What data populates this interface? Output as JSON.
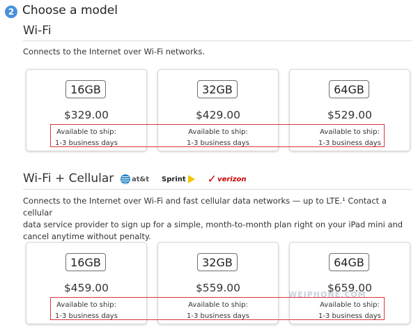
{
  "header": {
    "step_number": "2",
    "title": "Choose a model"
  },
  "wifi": {
    "title": "Wi-Fi",
    "description": "Connects to the Internet over Wi-Fi networks.",
    "models": [
      {
        "capacity": "16GB",
        "price": "$329.00",
        "ship_label": "Available to ship:",
        "ship_time": "1-3 business days"
      },
      {
        "capacity": "32GB",
        "price": "$429.00",
        "ship_label": "Available to ship:",
        "ship_time": "1-3 business days"
      },
      {
        "capacity": "64GB",
        "price": "$529.00",
        "ship_label": "Available to ship:",
        "ship_time": "1-3 business days"
      }
    ]
  },
  "cellular": {
    "title": "Wi-Fi + Cellular",
    "carriers": {
      "att": "at&t",
      "sprint": "Sprint",
      "verizon": "verizon"
    },
    "description_lines": [
      "Connects to the Internet over Wi-Fi and fast cellular data networks — up to LTE.¹ Contact a cellular",
      "data service provider to sign up for a simple, month-to-month plan right on your iPad mini and",
      "cancel anytime without penalty."
    ],
    "models": [
      {
        "capacity": "16GB",
        "price": "$459.00",
        "ship_label": "Available to ship:",
        "ship_time": "1-3 business days"
      },
      {
        "capacity": "32GB",
        "price": "$559.00",
        "ship_label": "Available to ship:",
        "ship_time": "1-3 business days"
      },
      {
        "capacity": "64GB",
        "price": "$659.00",
        "ship_label": "Available to ship:",
        "ship_time": "1-3 business days"
      }
    ]
  },
  "watermark": "WEIPHONE.COM",
  "colors": {
    "highlight": "#d9353b",
    "badge": "#4a90d9"
  }
}
